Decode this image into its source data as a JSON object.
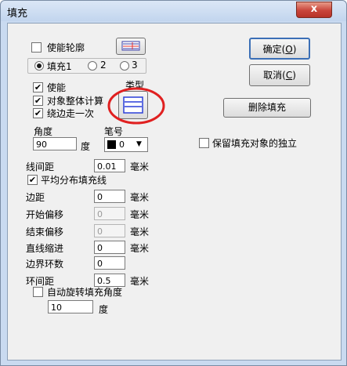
{
  "window": {
    "title": "填充",
    "close": "x"
  },
  "outline": {
    "label": "使能轮廓",
    "checked": false
  },
  "fill_tabs": [
    {
      "label": "填充1",
      "selected": true
    },
    {
      "label": "2",
      "selected": false
    },
    {
      "label": "3",
      "selected": false
    }
  ],
  "enable": {
    "label": "使能",
    "checked": true
  },
  "whole_calc": {
    "label": "对象整体计算",
    "checked": true
  },
  "edge_once": {
    "label": "绕边走一次",
    "checked": true
  },
  "type_label": "类型",
  "angle": {
    "label": "角度",
    "value": "90",
    "unit": "度"
  },
  "pen": {
    "label": "笔号",
    "value": "0",
    "arrow": "▼"
  },
  "line_spacing": {
    "label": "线间距",
    "value": "0.01",
    "unit": "毫米"
  },
  "average_dist": {
    "label": "平均分布填充线",
    "checked": true
  },
  "margin": {
    "label": "边距",
    "value": "0",
    "unit": "毫米"
  },
  "start_offset": {
    "label": "开始偏移",
    "value": "0",
    "unit": "毫米"
  },
  "end_offset": {
    "label": "结束偏移",
    "value": "0",
    "unit": "毫米"
  },
  "line_reduce": {
    "label": "直线缩进",
    "value": "0",
    "unit": "毫米"
  },
  "border_loops": {
    "label": "边界环数",
    "value": "0"
  },
  "loop_spacing": {
    "label": "环间距",
    "value": "0.5",
    "unit": "毫米"
  },
  "auto_rotate": {
    "label": "自动旋转填充角度",
    "checked": false,
    "value": "10",
    "unit": "度"
  },
  "buttons": {
    "ok": "确定",
    "ok_key": "O",
    "cancel": "取消",
    "cancel_key": "C",
    "delete": "删除填充"
  },
  "keep_fill": {
    "label": "保留填充对象的独立",
    "checked": false
  },
  "colors": {
    "highlight_circle": "#e02020",
    "type_icon": "#2a3fd8",
    "outline_icon_line": "#e03030"
  }
}
